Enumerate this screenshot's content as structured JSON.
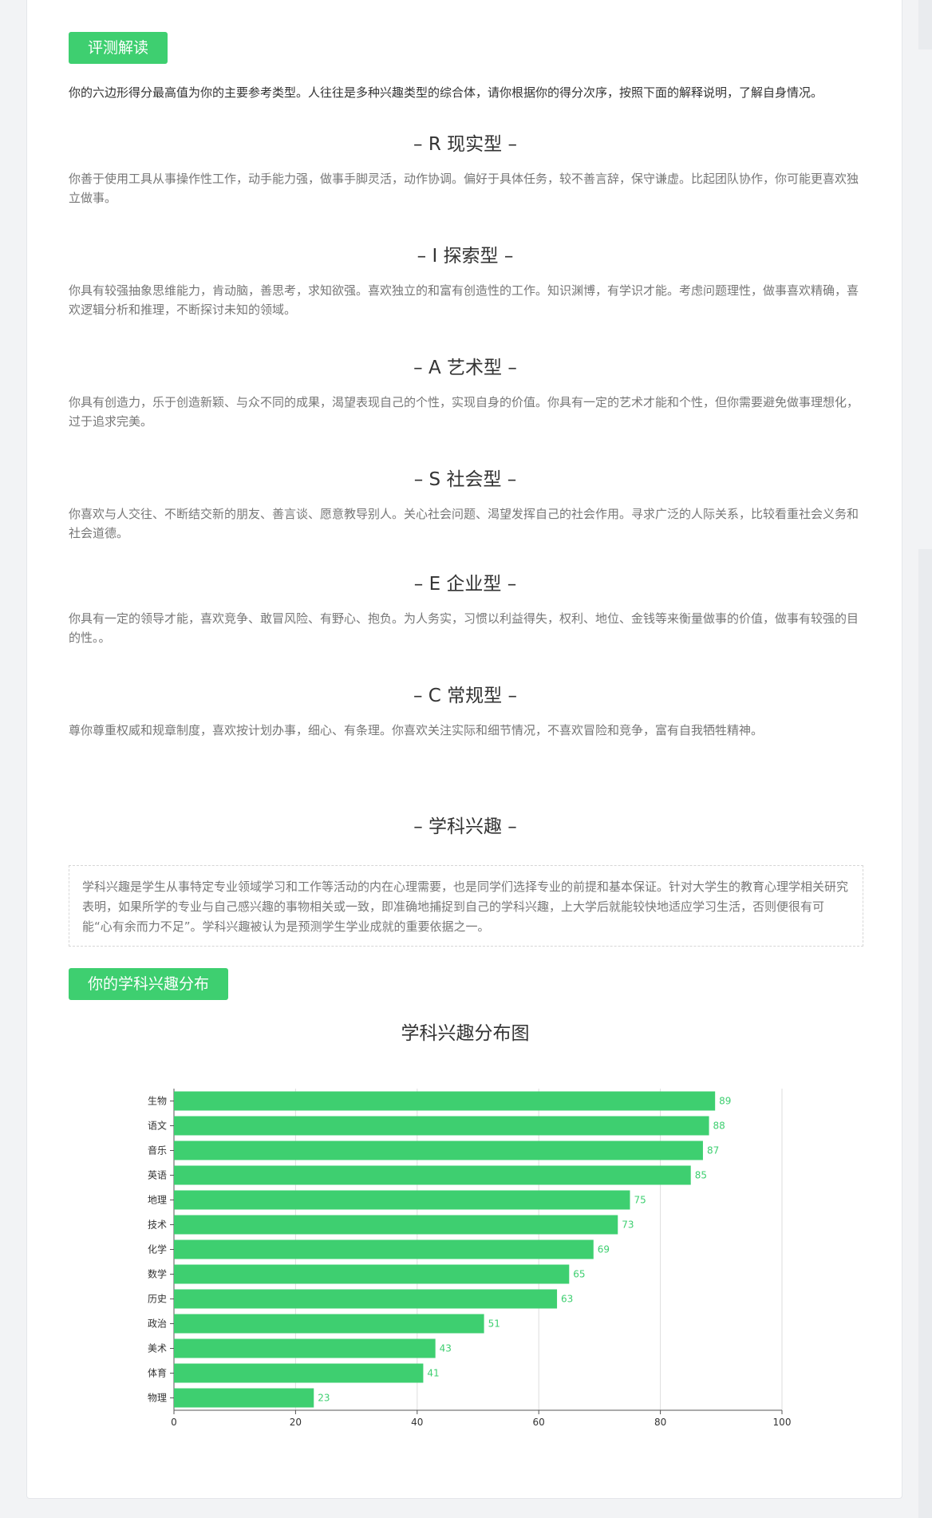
{
  "header": {
    "badge": "评测解读"
  },
  "intro": "你的六边形得分最高值为你的主要参考类型。人往往是多种兴趣类型的综合体，请你根据你的得分次序，按照下面的解释说明，了解自身情况。",
  "types": [
    {
      "title": "– R 现实型 –",
      "desc": "你善于使用工具从事操作性工作，动手能力强，做事手脚灵活，动作协调。偏好于具体任务，较不善言辞，保守谦虚。比起团队协作，你可能更喜欢独立做事。"
    },
    {
      "title": "– I 探索型 –",
      "desc": "你具有较强抽象思维能力，肯动脑，善思考，求知欲强。喜欢独立的和富有创造性的工作。知识渊博，有学识才能。考虑问题理性，做事喜欢精确，喜欢逻辑分析和推理，不断探讨未知的领域。"
    },
    {
      "title": "– A 艺术型 –",
      "desc": "你具有创造力，乐于创造新颖、与众不同的成果，渴望表现自己的个性，实现自身的价值。你具有一定的艺术才能和个性，但你需要避免做事理想化，过于追求完美。"
    },
    {
      "title": "– S 社会型 –",
      "desc": "你喜欢与人交往、不断结交新的朋友、善言谈、愿意教导别人。关心社会问题、渴望发挥自己的社会作用。寻求广泛的人际关系，比较看重社会义务和社会道德。"
    },
    {
      "title": "– E 企业型 –",
      "desc": "你具有一定的领导才能，喜欢竞争、敢冒风险、有野心、抱负。为人务实，习惯以利益得失，权利、地位、金钱等来衡量做事的价值，做事有较强的目的性。。"
    },
    {
      "title": "– C 常规型 –",
      "desc": "尊你尊重权威和规章制度，喜欢按计划办事，细心、有条理。你喜欢关注实际和细节情况，不喜欢冒险和竞争，富有自我牺牲精神。"
    }
  ],
  "subject": {
    "title": "– 学科兴趣 –",
    "notice": "学科兴趣是学生从事特定专业领域学习和工作等活动的内在心理需要，也是同学们选择专业的前提和基本保证。针对大学生的教育心理学相关研究表明，如果所学的专业与自己感兴趣的事物相关或一致，即准确地捕捉到自己的学科兴趣，上大学后就能较快地适应学习生活，否则便很有可能“心有余而力不足”。学科兴趣被认为是预测学生学业成就的重要依据之一。",
    "badge": "你的学科兴趣分布"
  },
  "chart_data": {
    "type": "bar",
    "orientation": "horizontal",
    "title": "学科兴趣分布图",
    "categories": [
      "生物",
      "语文",
      "音乐",
      "英语",
      "地理",
      "技术",
      "化学",
      "数学",
      "历史",
      "政治",
      "美术",
      "体育",
      "物理"
    ],
    "values": [
      89,
      88,
      87,
      85,
      75,
      73,
      69,
      65,
      63,
      51,
      43,
      41,
      23
    ],
    "xlim": [
      0,
      100
    ],
    "xticks": [
      0,
      20,
      40,
      60,
      80,
      100
    ],
    "grid": true,
    "bar_color": "#3ecf70",
    "label_color": "#3ecf70"
  }
}
